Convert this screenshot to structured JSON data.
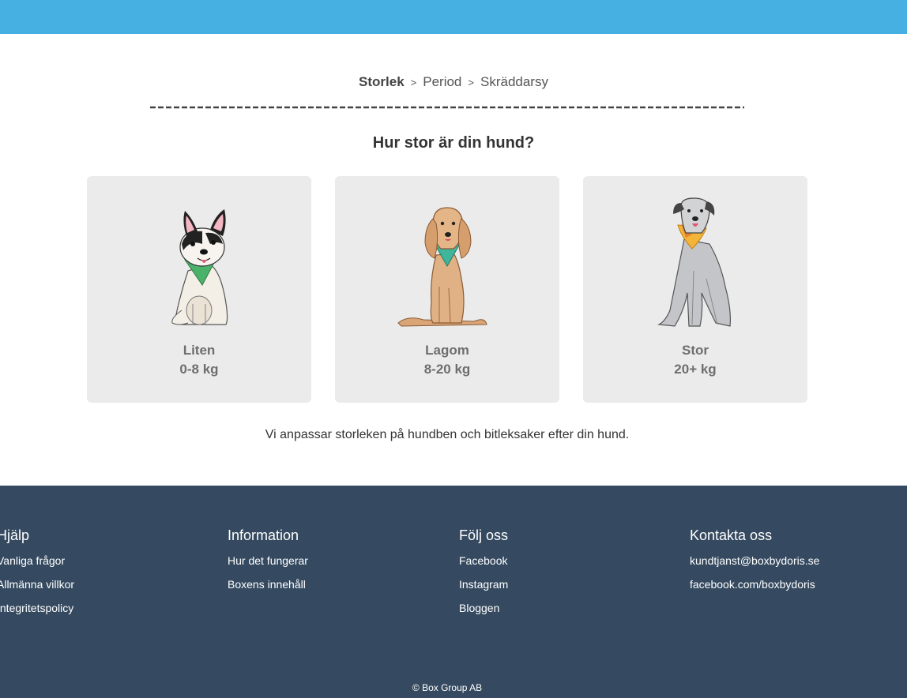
{
  "steps": {
    "step1": "Storlek",
    "sep1": ">",
    "step2": "Period",
    "sep2": ">",
    "step3": "Skräddarsy"
  },
  "question": "Hur stor är din hund?",
  "options": [
    {
      "name": "Liten",
      "weight": "0-8 kg",
      "icon": "french-bulldog-icon"
    },
    {
      "name": "Lagom",
      "weight": "8-20 kg",
      "icon": "setter-dog-icon"
    },
    {
      "name": "Stor",
      "weight": "20+ kg",
      "icon": "greyhound-dog-icon"
    }
  ],
  "note": "Vi anpassar storleken på hundben och bitleksaker efter din hund.",
  "footer": {
    "help": {
      "title": "Hjälp",
      "links": [
        "Vanliga frågor",
        "Allmänna villkor",
        "Integritetspolicy"
      ]
    },
    "info": {
      "title": "Information",
      "links": [
        "Hur det fungerar",
        "Boxens innehåll"
      ]
    },
    "follow": {
      "title": "Följ oss",
      "links": [
        "Facebook",
        "Instagram",
        "Bloggen"
      ]
    },
    "contact": {
      "title": "Kontakta oss",
      "links": [
        "kundtjanst@boxbydoris.se",
        "facebook.com/boxbydoris"
      ]
    },
    "copyright": "© Box Group AB"
  },
  "colors": {
    "topbar": "#47b0e2",
    "footer": "#354a60",
    "card": "#ebebeb"
  }
}
